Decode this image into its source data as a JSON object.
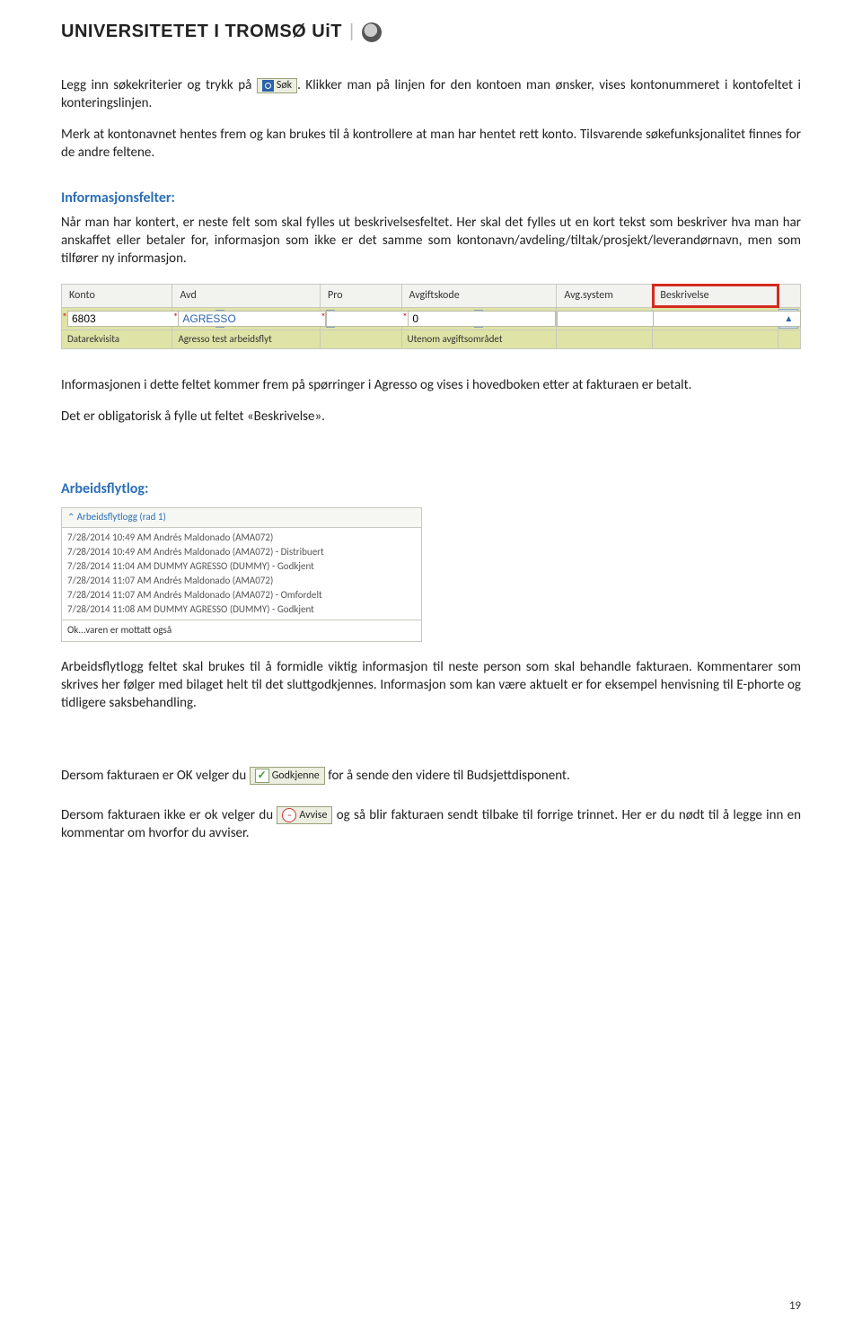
{
  "header": {
    "org_name": "UNIVERSITETET I TROMSØ",
    "short": "UiT"
  },
  "buttons": {
    "sok": "Søk",
    "godkjenne": "Godkjenne",
    "avvise": "Avvise"
  },
  "para1a": "Legg inn søkekriterier og trykk på ",
  "para1b": ". Klikker man på linjen for den kontoen man ønsker, vises kontonummeret i kontofeltet i konteringslinjen.",
  "para2": "Merk at kontonavnet hentes frem og kan brukes til å kontrollere at man har hentet rett konto. Tilsvarende søkefunksjonalitet finnes for de andre feltene.",
  "info_heading": "Informasjonsfelter:",
  "info_para": "Når man har kontert, er neste felt som skal fylles ut beskrivelsesfeltet. Her skal det fylles ut en kort tekst som beskriver hva man har anskaffet eller betaler for, informasjon som ikke er det samme som kontonavn/avdeling/tiltak/prosjekt/leverandørnavn, men som tilfører ny informasjon.",
  "grid": {
    "headers": [
      "Konto",
      "Avd",
      "Pro",
      "Avgiftskode",
      "Avg.system",
      "Beskrivelse"
    ],
    "row": {
      "konto": "6803",
      "avd": "AGRESSO",
      "pro": "",
      "avgkode": "0",
      "avgsys": "",
      "besk": ""
    },
    "desc": {
      "konto": "Datarekvisita",
      "avd": "Agresso test arbeidsflyt",
      "pro": "",
      "avgkode": "Utenom avgiftsområdet",
      "avgsys": "",
      "besk": ""
    }
  },
  "after_grid_1": "Informasjonen i dette feltet kommer frem på spørringer i Agresso og vises i hovedboken etter at fakturaen er betalt.",
  "after_grid_2": "Det er obligatorisk å fylle ut feltet «Beskrivelse».",
  "wf_heading": "Arbeidsflytlog:",
  "wf_title": "Arbeidsflytlogg (rad 1)",
  "wf_entries": [
    "7/28/2014 10:49 AM Andrés Maldonado (AMA072)",
    "7/28/2014 10:49 AM Andrés Maldonado (AMA072) - Distribuert",
    "7/28/2014 11:04 AM DUMMY AGRESSO (DUMMY) - Godkjent",
    "7/28/2014 11:07 AM Andrés Maldonado (AMA072)",
    "7/28/2014 11:07 AM Andrés Maldonado (AMA072) - Omfordelt",
    "7/28/2014 11:08 AM DUMMY AGRESSO (DUMMY) - Godkjent"
  ],
  "wf_comment": "Ok...varen er mottatt også",
  "wf_para": "Arbeidsflytlogg feltet skal brukes til å formidle viktig informasjon til neste person som skal behandle fakturaen. Kommentarer som skrives her følger med bilaget helt til det sluttgodkjennes. Informasjon som kan være aktuelt er for eksempel henvisning til E-phorte og tidligere saksbehandling.",
  "ok_para_a": "Dersom fakturaen er OK velger du ",
  "ok_para_b": " for å sende den videre til Budsjettdisponent.",
  "nok_para_a": "Dersom fakturaen ikke er ok velger du ",
  "nok_para_b": " og så blir fakturaen sendt tilbake til forrige trinnet. Her er du nødt til å legge inn en kommentar om hvorfor du avviser.",
  "page_number": "19"
}
